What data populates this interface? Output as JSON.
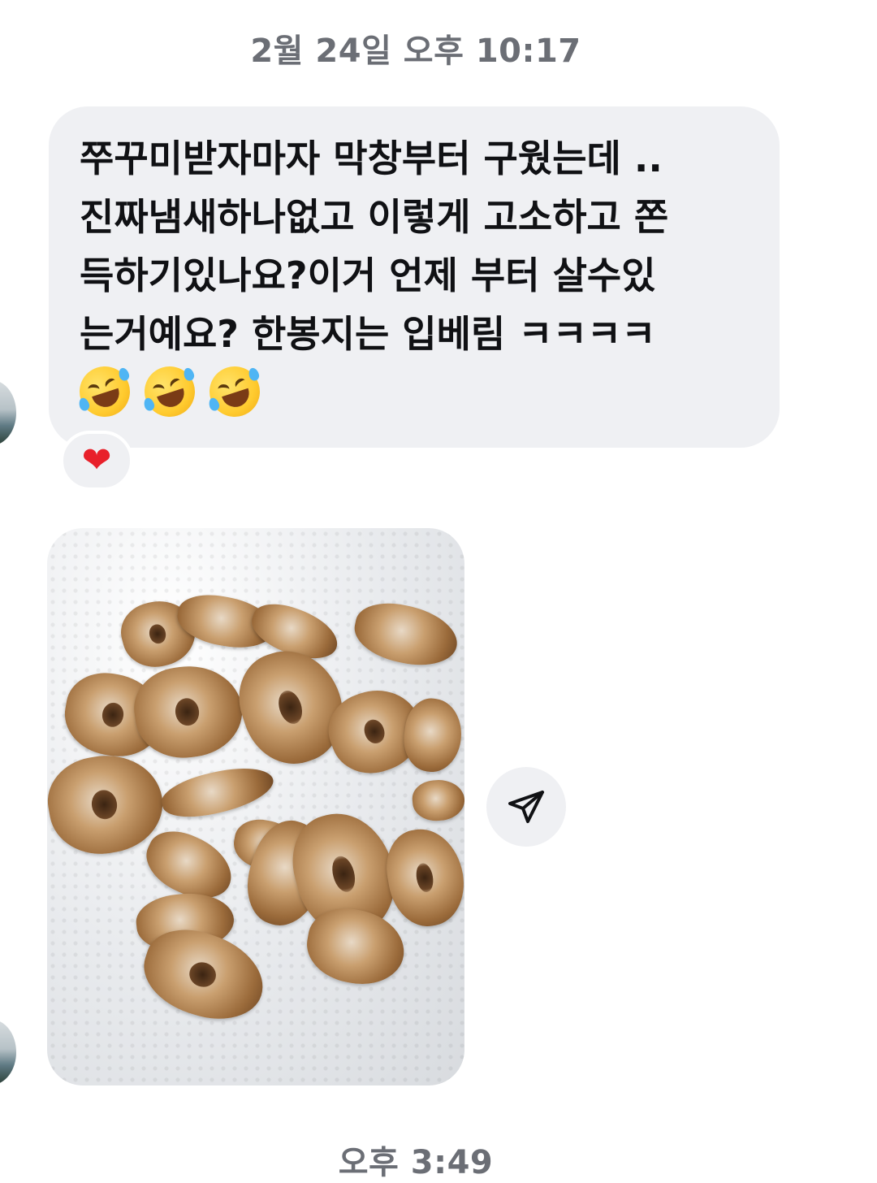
{
  "thread": {
    "timestamp_top": "2월 24일 오후 10:17",
    "timestamp_bottom": "오후 3:49"
  },
  "message": {
    "text": "쭈꾸미받자마자 막창부터 구웠는데 ..\n진짜냄새하나없고 이렇게 고소하고 쫀\n득하기있나요?이거 언제 부터 살수있\n는거예요? 한봉지는 입베림 ㅋㅋㅋㅋ",
    "emojis": [
      "rolling-on-floor-laughing-emoji",
      "rolling-on-floor-laughing-emoji",
      "rolling-on-floor-laughing-emoji"
    ],
    "reaction": "❤",
    "reaction_color": "#e8202a",
    "bubble_color": "#eff0f3"
  },
  "attachment": {
    "type": "photo",
    "icon": "send-icon"
  }
}
